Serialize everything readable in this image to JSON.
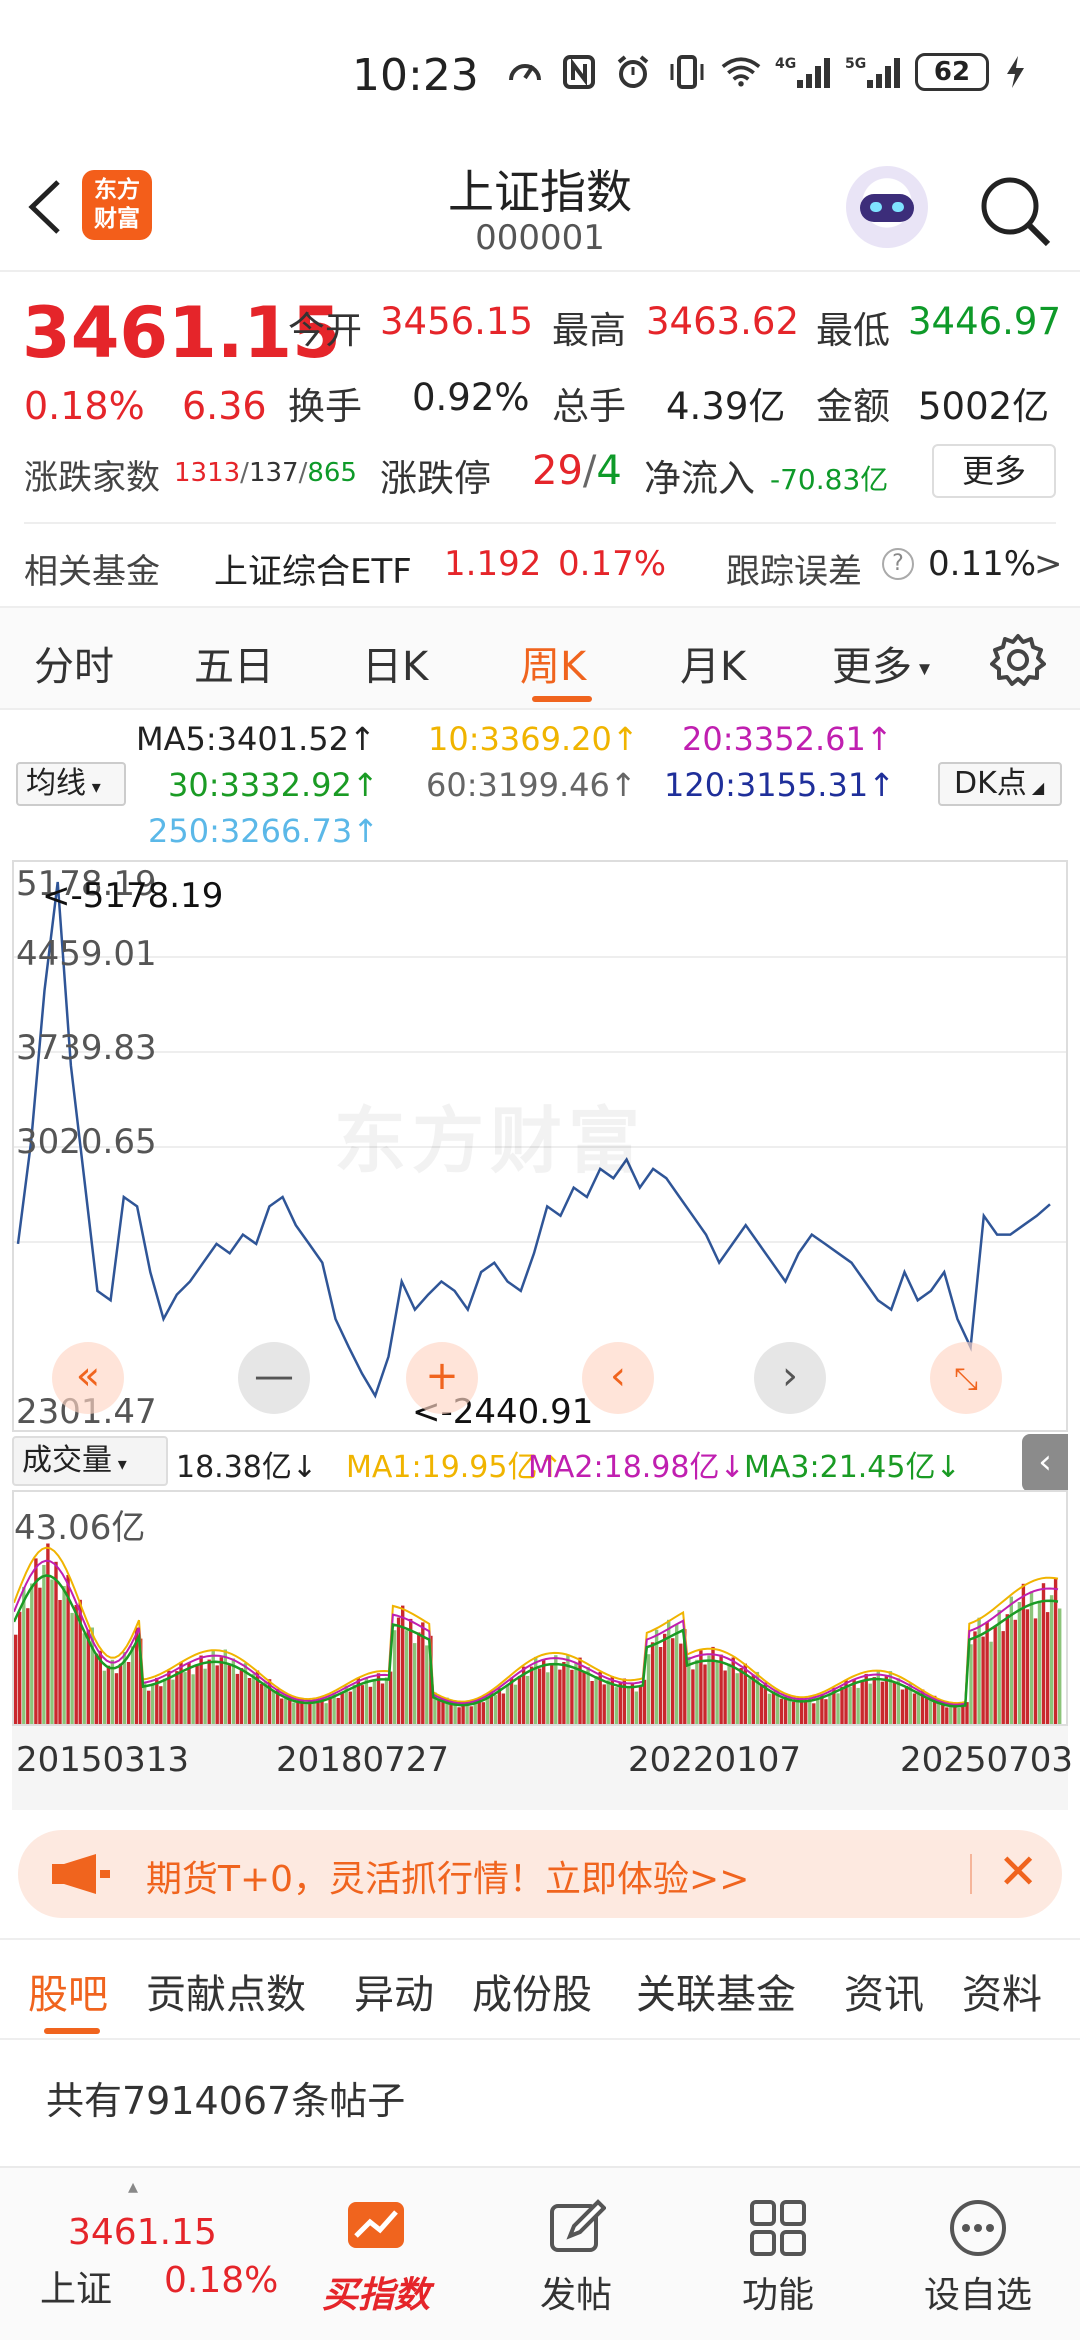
{
  "status": {
    "time": "10:23",
    "battery": "62",
    "net1": "4G",
    "net2": "5G"
  },
  "header": {
    "logo": "东方\n财富",
    "title": "上证指数",
    "code": "000001"
  },
  "quote": {
    "price": "3461.15",
    "pct": "0.18%",
    "change": "6.36",
    "open_label": "今开",
    "open": "3456.15",
    "high_label": "最高",
    "high": "3463.62",
    "low_label": "最低",
    "low": "3446.97",
    "turnover_label": "换手",
    "turnover": "0.92%",
    "volume_label": "总手",
    "volume": "4.39亿",
    "amount_label": "金额",
    "amount": "5002亿",
    "breadth_label": "涨跌家数",
    "up": "1313",
    "flat": "137",
    "down": "865",
    "limit_label": "涨跌停",
    "limit_up": "29",
    "limit_down": "4",
    "flow_label": "净流入",
    "flow": "-70.83亿",
    "more": "更多"
  },
  "fund": {
    "label": "相关基金",
    "name": "上证综合ETF",
    "price": "1.192",
    "pct": "0.17%",
    "err_label": "跟踪误差",
    "err": "0.11%"
  },
  "tabs": [
    "分时",
    "五日",
    "日K",
    "周K",
    "月K",
    "更多"
  ],
  "ma": {
    "select": "均线",
    "dk": "DK点",
    "ma5": "MA5:3401.52↑",
    "ma10": "10:3369.20↑",
    "ma20": "20:3352.61↑",
    "ma30": "30:3332.92↑",
    "ma60": "60:3199.46↑",
    "ma120": "120:3155.31↑",
    "ma250": "250:3266.73↑",
    "c5": "#222222",
    "c10": "#f0b400",
    "c20": "#c01fb0",
    "c30": "#1a9b24",
    "c60": "#666666",
    "c120": "#1f2f9a",
    "c250": "#5bb8e8"
  },
  "chart": {
    "y_labels": [
      "5178.19",
      "4459.01",
      "3739.83",
      "3020.65",
      "2301.47"
    ],
    "high_note": "<-5178.19",
    "low_note": "<-2440.91",
    "watermark": "东方财富",
    "line_color": "#2f5597"
  },
  "chart_data": {
    "type": "line",
    "title": "",
    "ylim": [
      2301.47,
      5178.19
    ],
    "x_ticks": [
      "20150313",
      "20180727",
      "20220107",
      "20250703"
    ],
    "series": [
      {
        "values": [
          3250,
          3800,
          4600,
          5178,
          4200,
          3600,
          3000,
          2950,
          3500,
          3450,
          3100,
          2850,
          2980,
          3050,
          3150,
          3250,
          3200,
          3300,
          3250,
          3450,
          3500,
          3350,
          3250,
          3150,
          2850,
          2700,
          2560,
          2441,
          2650,
          3050,
          2900,
          2980,
          3050,
          3000,
          2900,
          3100,
          3150,
          3050,
          3000,
          3200,
          3450,
          3400,
          3550,
          3500,
          3650,
          3600,
          3700,
          3550,
          3650,
          3600,
          3500,
          3400,
          3300,
          3150,
          3250,
          3350,
          3250,
          3150,
          3050,
          3200,
          3300,
          3250,
          3200,
          3150,
          3050,
          2950,
          2900,
          3100,
          2950,
          3000,
          3100,
          2850,
          2700,
          3400,
          3300,
          3300,
          3350,
          3400,
          3461
        ]
      }
    ],
    "volume_max": "43.06亿"
  },
  "vol": {
    "select": "成交量",
    "v": "18.38亿↓",
    "ma1": "MA1:19.95亿↑",
    "ma2": "MA2:18.98亿↓",
    "ma3": "MA3:21.45亿↓",
    "collapse": "‹"
  },
  "dates": [
    "20150313",
    "20180727",
    "20220107",
    "20250703"
  ],
  "banner": {
    "text": "期货T+0，灵活抓行情！立即体验>>",
    "close": "✕"
  },
  "subtabs": [
    "股吧",
    "贡献点数",
    "异动",
    "成份股",
    "关联基金",
    "资讯",
    "资料"
  ],
  "posts": "共有7914067条帖子",
  "bottom": {
    "price": "3461.15",
    "name": "上证",
    "pct": "0.18%",
    "buy": "买指数",
    "post": "发帖",
    "func": "功能",
    "fav": "设自选"
  }
}
